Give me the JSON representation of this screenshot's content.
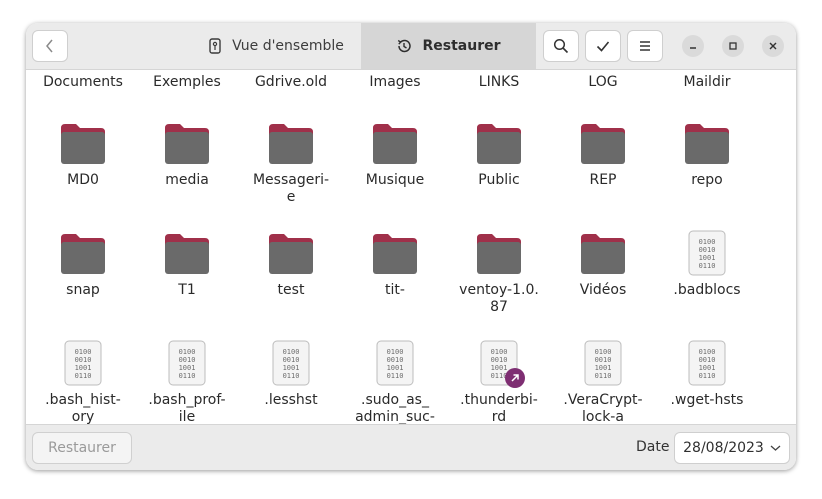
{
  "header": {
    "tabs": [
      {
        "label": "Vue d'ensemble",
        "active": false
      },
      {
        "label": "Restaurer",
        "active": true
      }
    ]
  },
  "files_top_row": [
    "Documents",
    "Exemples",
    "Gdrive.old",
    "Images",
    "LINKS",
    "LOG",
    "Maildir"
  ],
  "files_row1": [
    "MD0",
    "media",
    "Messageri-e",
    "Musique",
    "Public",
    "REP",
    "repo"
  ],
  "files_row2": [
    "snap",
    "T1",
    "test",
    "tit-",
    "ventoy-1.0.87",
    "Vidéos",
    ".badblocs"
  ],
  "files_row3": [
    ".bash_hist-ory",
    ".bash_prof-ile",
    ".lesshst",
    ".sudo_as_admin_suc-",
    ".thunderbi-rd",
    ".VeraCrypt-lock-a",
    ".wget-hsts"
  ],
  "display": {
    "row1": [
      "MD0",
      "media",
      "Messageri-\ne",
      "Musique",
      "Public",
      "REP",
      "repo"
    ],
    "row2": [
      "snap",
      "T1",
      "test",
      "tit-",
      "ventoy-1.0.\n87",
      "Vidéos",
      ".badblocs"
    ],
    "row3": [
      ".bash_hist-\nory",
      ".bash_prof-\nile",
      ".lesshst",
      ".sudo_as_\nadmin_suc-",
      ".thunderbi-\nrd",
      ".VeraCrypt-\nlock-a",
      ".wget-hsts"
    ]
  },
  "footer": {
    "restore_label": "Restaurer",
    "date_label": "Date",
    "date_value": "28/08/2023"
  },
  "colors": {
    "folder_tab": "#a0304a",
    "folder_body": "#6a6a6a",
    "link_badge": "#7e2e72"
  },
  "icons": {
    "text_file": "binary-file-icon",
    "folder": "folder-icon"
  },
  "binary_glyph_lines": [
    "0100",
    "0010",
    "1001",
    "0110"
  ]
}
